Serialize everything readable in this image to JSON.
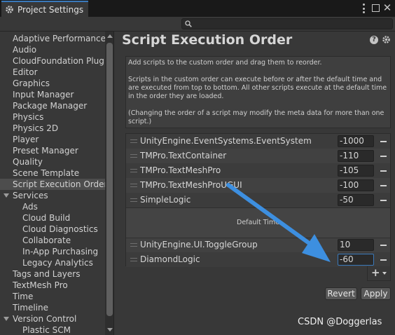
{
  "window": {
    "title": "Project Settings"
  },
  "search": {
    "placeholder": ""
  },
  "sidebar": {
    "items": [
      {
        "label": "Adaptive Performance"
      },
      {
        "label": "Audio"
      },
      {
        "label": "CloudFoundation Plugin"
      },
      {
        "label": "Editor"
      },
      {
        "label": "Graphics"
      },
      {
        "label": "Input Manager"
      },
      {
        "label": "Package Manager"
      },
      {
        "label": "Physics"
      },
      {
        "label": "Physics 2D"
      },
      {
        "label": "Player"
      },
      {
        "label": "Preset Manager"
      },
      {
        "label": "Quality"
      },
      {
        "label": "Scene Template"
      },
      {
        "label": "Script Execution Order",
        "selected": true
      },
      {
        "label": "Services",
        "group": true
      },
      {
        "label": "Ads",
        "child": true
      },
      {
        "label": "Cloud Build",
        "child": true
      },
      {
        "label": "Cloud Diagnostics",
        "child": true
      },
      {
        "label": "Collaborate",
        "child": true
      },
      {
        "label": "In-App Purchasing",
        "child": true
      },
      {
        "label": "Legacy Analytics",
        "child": true
      },
      {
        "label": "Tags and Layers"
      },
      {
        "label": "TextMesh Pro"
      },
      {
        "label": "Time"
      },
      {
        "label": "Timeline"
      },
      {
        "label": "Version Control",
        "group": true
      },
      {
        "label": "Plastic SCM",
        "child": true
      }
    ]
  },
  "main": {
    "title": "Script Execution Order",
    "help": {
      "p1": "Add scripts to the custom order and drag them to reorder.",
      "p2": "Scripts in the custom order can execute before or after the default time and are executed from top to bottom. All other scripts execute at the default time in the order they are loaded.",
      "p3": "(Changing the order of a script may modify the meta data for more than one script.)"
    },
    "scripts_before": [
      {
        "name": "UnityEngine.EventSystems.EventSystem",
        "value": "-1000"
      },
      {
        "name": "TMPro.TextContainer",
        "value": "-110"
      },
      {
        "name": "TMPro.TextMeshPro",
        "value": "-105"
      },
      {
        "name": "TMPro.TextMeshProUGUI",
        "value": "-100"
      },
      {
        "name": "SimpleLogic",
        "value": "-50"
      }
    ],
    "default_time_label": "Default Time",
    "scripts_after": [
      {
        "name": "UnityEngine.UI.ToggleGroup",
        "value": "10"
      },
      {
        "name": "DiamondLogic",
        "value": "-60"
      }
    ],
    "add_label": "+",
    "revert_label": "Revert",
    "apply_label": "Apply"
  },
  "annotation": {
    "arrow_color": "#3d8fe0"
  },
  "watermark": "CSDN @Doggerlas",
  "colors": {
    "accent": "#3a79bb",
    "background": "#383838"
  }
}
